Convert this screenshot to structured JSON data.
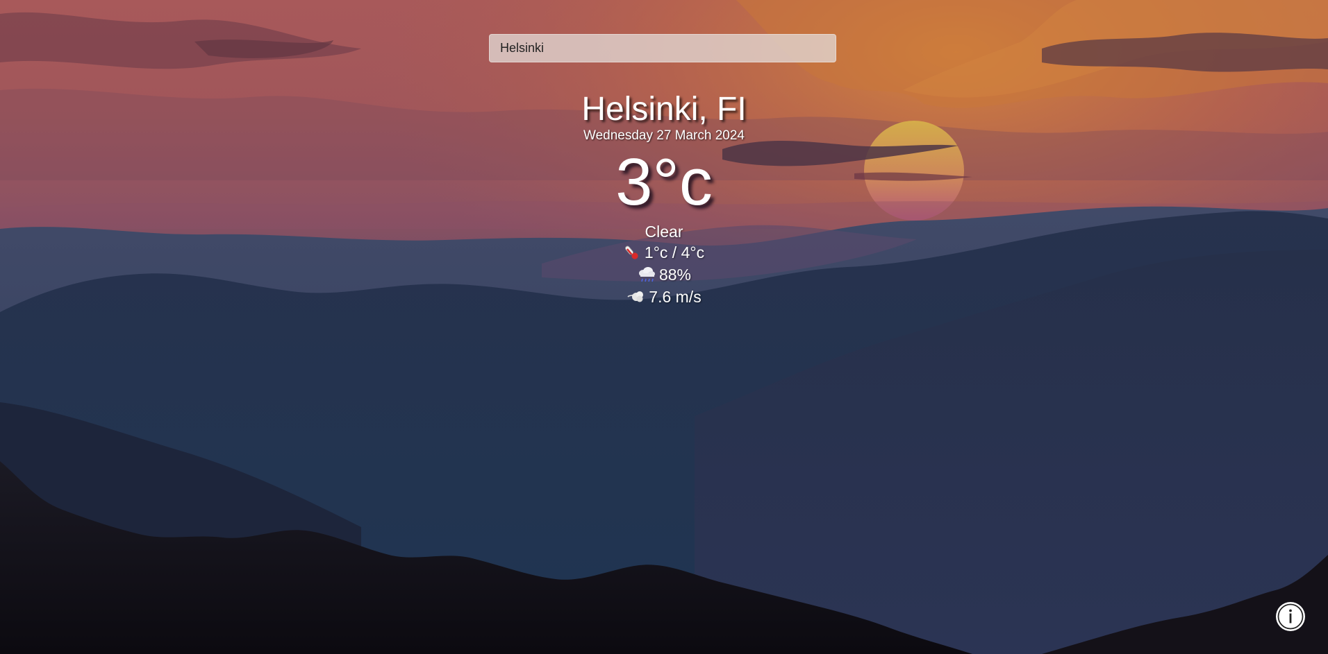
{
  "search": {
    "value": "Helsinki",
    "placeholder": ""
  },
  "weather": {
    "location": "Helsinki, FI",
    "date": "Wednesday 27 March 2024",
    "temperature": "3°c",
    "condition": "Clear",
    "min_max": "1°c / 4°c",
    "humidity": "88%",
    "wind": "7.6 m/s"
  },
  "icons": {
    "thermometer": "thermometer-icon",
    "rain": "rain-cloud-icon",
    "wind": "wind-icon",
    "info": "info-icon"
  },
  "colors": {
    "text": "#ffffff",
    "search_bg": "#e1d7d4",
    "sky_top": "#a85a52",
    "sky_warm": "#c8743a",
    "mountains_far": "#3e4a66",
    "mountains_mid": "#26334e",
    "mountains_front": "#141118"
  }
}
